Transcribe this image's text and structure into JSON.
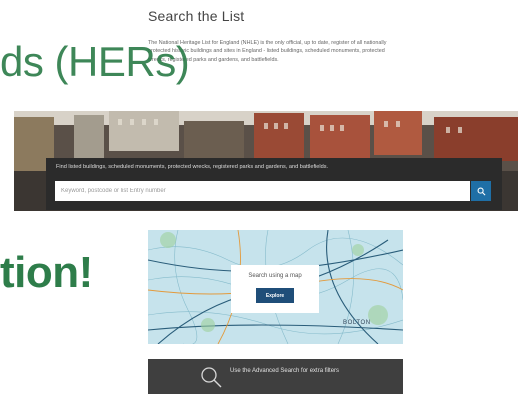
{
  "page": {
    "heading": "Search the List",
    "intro": "The National Heritage List for England (NHLE) is the only official, up to date, register of all nationally protected historic buildings and sites in England - listed buildings, scheduled monuments, protected wrecks, registered parks and gardens, and battlefields.",
    "overlay_top": "ds (HERs)",
    "overlay_bottom": "tion!"
  },
  "search": {
    "hint": "Find listed buildings, scheduled monuments, protected wrecks, registered parks and gardens, and battlefields.",
    "placeholder": "Keyword, postcode or list Entry number",
    "button_icon": "search-icon"
  },
  "map": {
    "card_text": "Search using a map",
    "button_label": "Explore",
    "place_label": "BOLTON"
  },
  "advanced": {
    "text": "Use the Advanced Search for extra filters",
    "icon": "search-icon"
  },
  "colors": {
    "accent_green": "#2e7d4a",
    "button_blue": "#1f6fa6",
    "explore_blue": "#1f4e79",
    "dark_panel": "#2b2b2b"
  }
}
